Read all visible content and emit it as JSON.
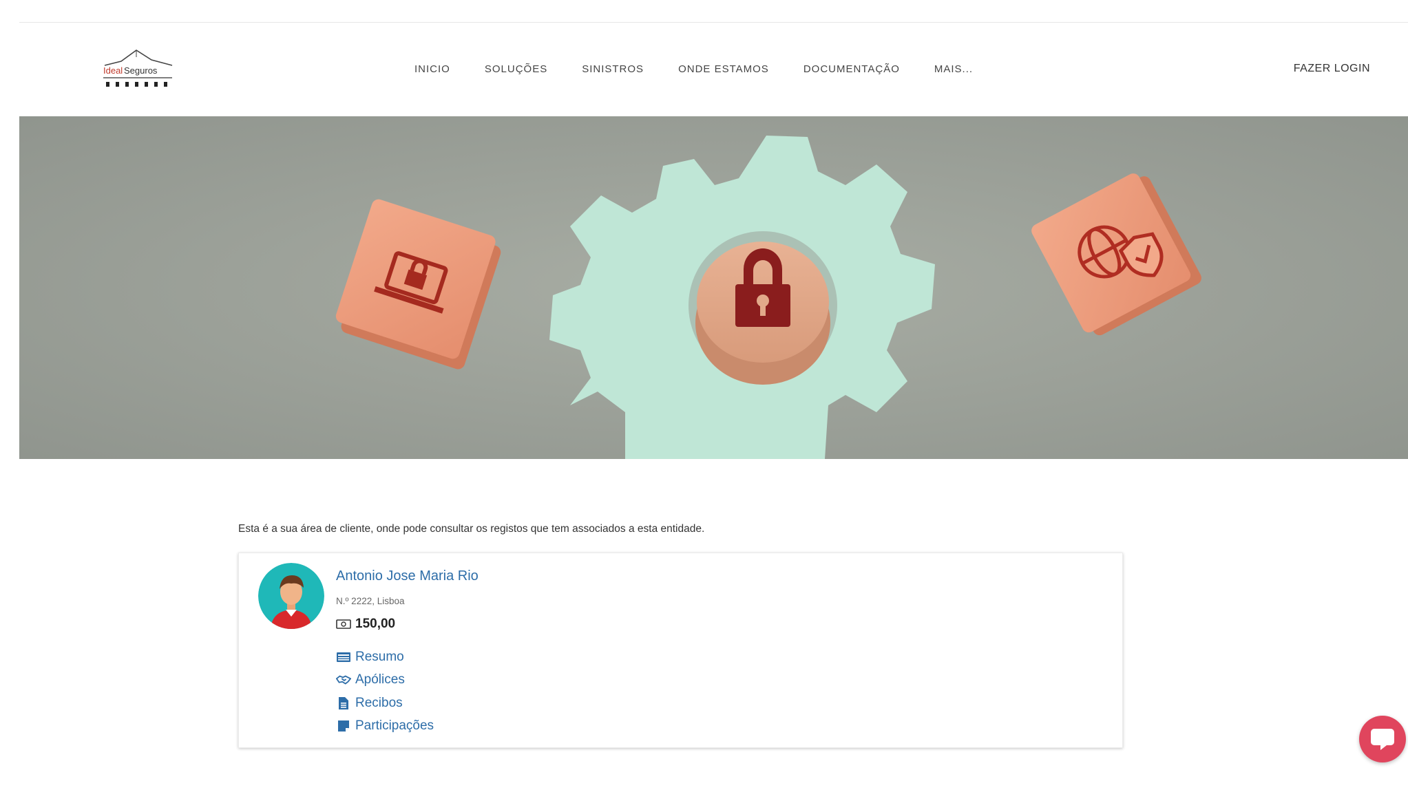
{
  "header": {
    "logo_text": "Ideal Seguros",
    "nav": [
      "INICIO",
      "SOLUÇÕES",
      "SINISTROS",
      "ONDE ESTAMOS",
      "DOCUMENTAÇÃO",
      "MAIS..."
    ],
    "login_label": "FAZER LOGIN"
  },
  "hero": {
    "icons": [
      "laptop-lock-icon",
      "padlock-icon",
      "globe-shield-icon"
    ]
  },
  "main": {
    "intro": "Esta é a sua área de cliente, onde pode consultar os registos que tem associados a esta entidade.",
    "client": {
      "name": "Antonio Jose Maria Rio",
      "meta": "N.º 2222, Lisboa",
      "balance": "150,00"
    },
    "links": [
      {
        "label": "Resumo",
        "icon": "list-card-icon"
      },
      {
        "label": "Apólices",
        "icon": "handshake-icon"
      },
      {
        "label": "Recibos",
        "icon": "document-icon"
      },
      {
        "label": "Participações",
        "icon": "note-icon"
      }
    ]
  },
  "colors": {
    "link": "#2d6da8",
    "chat": "#e0455d",
    "avatar_bg": "#1fb8b8"
  }
}
